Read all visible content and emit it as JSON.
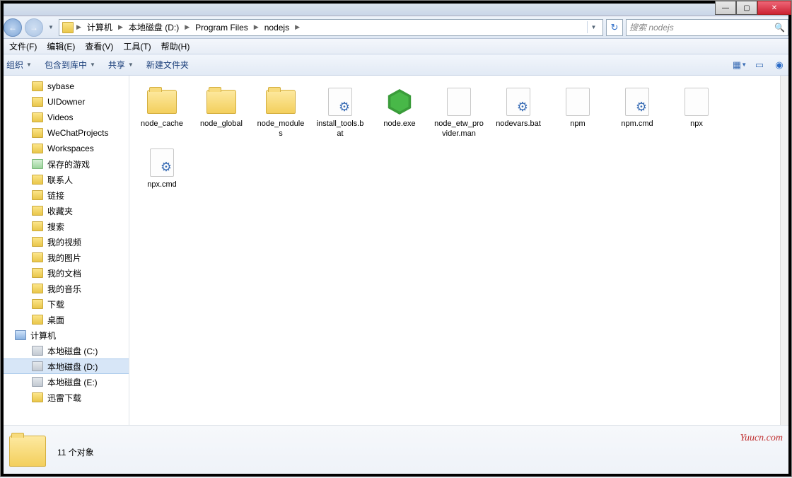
{
  "window_controls": {
    "min": "—",
    "max": "▢",
    "close": "✕"
  },
  "nav": {
    "back": "←",
    "forward": "→"
  },
  "breadcrumb": {
    "items": [
      "计算机",
      "本地磁盘 (D:)",
      "Program Files",
      "nodejs"
    ]
  },
  "refresh_label": "↻",
  "search": {
    "placeholder": "搜索 nodejs",
    "icon": "🔍"
  },
  "menubar": {
    "file": "文件(F)",
    "edit": "编辑(E)",
    "view": "查看(V)",
    "tools": "工具(T)",
    "help": "帮助(H)"
  },
  "toolbar": {
    "organize": "组织",
    "include": "包含到库中",
    "share": "共享",
    "newfolder": "新建文件夹"
  },
  "sidebar": {
    "items": [
      {
        "label": "sybase",
        "type": "folder",
        "level": 1
      },
      {
        "label": "UIDowner",
        "type": "folder",
        "level": 1
      },
      {
        "label": "Videos",
        "type": "folder",
        "level": 1
      },
      {
        "label": "WeChatProjects",
        "type": "folder",
        "level": 1
      },
      {
        "label": "Workspaces",
        "type": "folder",
        "level": 1
      },
      {
        "label": "保存的游戏",
        "type": "special",
        "level": 1
      },
      {
        "label": "联系人",
        "type": "folder",
        "level": 1
      },
      {
        "label": "链接",
        "type": "folder",
        "level": 1
      },
      {
        "label": "收藏夹",
        "type": "folder",
        "level": 1
      },
      {
        "label": "搜索",
        "type": "folder",
        "level": 1
      },
      {
        "label": "我的视频",
        "type": "folder",
        "level": 1
      },
      {
        "label": "我的图片",
        "type": "folder",
        "level": 1
      },
      {
        "label": "我的文档",
        "type": "folder",
        "level": 1
      },
      {
        "label": "我的音乐",
        "type": "folder",
        "level": 1
      },
      {
        "label": "下载",
        "type": "folder",
        "level": 1
      },
      {
        "label": "桌面",
        "type": "folder",
        "level": 1
      },
      {
        "label": "计算机",
        "type": "comp",
        "level": 0
      },
      {
        "label": "本地磁盘 (C:)",
        "type": "drive",
        "level": 1
      },
      {
        "label": "本地磁盘 (D:)",
        "type": "drive",
        "level": 1,
        "selected": true
      },
      {
        "label": "本地磁盘 (E:)",
        "type": "drive",
        "level": 1
      },
      {
        "label": "迅雷下载",
        "type": "folder",
        "level": 1
      }
    ]
  },
  "files": [
    {
      "name": "node_cache",
      "type": "folder"
    },
    {
      "name": "node_global",
      "type": "folder"
    },
    {
      "name": "node_modules",
      "type": "folder"
    },
    {
      "name": "install_tools.bat",
      "type": "gear"
    },
    {
      "name": "node.exe",
      "type": "hex"
    },
    {
      "name": "node_etw_provider.man",
      "type": "file"
    },
    {
      "name": "nodevars.bat",
      "type": "gear"
    },
    {
      "name": "npm",
      "type": "file"
    },
    {
      "name": "npm.cmd",
      "type": "gear"
    },
    {
      "name": "npx",
      "type": "file"
    },
    {
      "name": "npx.cmd",
      "type": "gear"
    }
  ],
  "status": {
    "count": "11 个对象"
  },
  "watermark": "Yuucn.com"
}
